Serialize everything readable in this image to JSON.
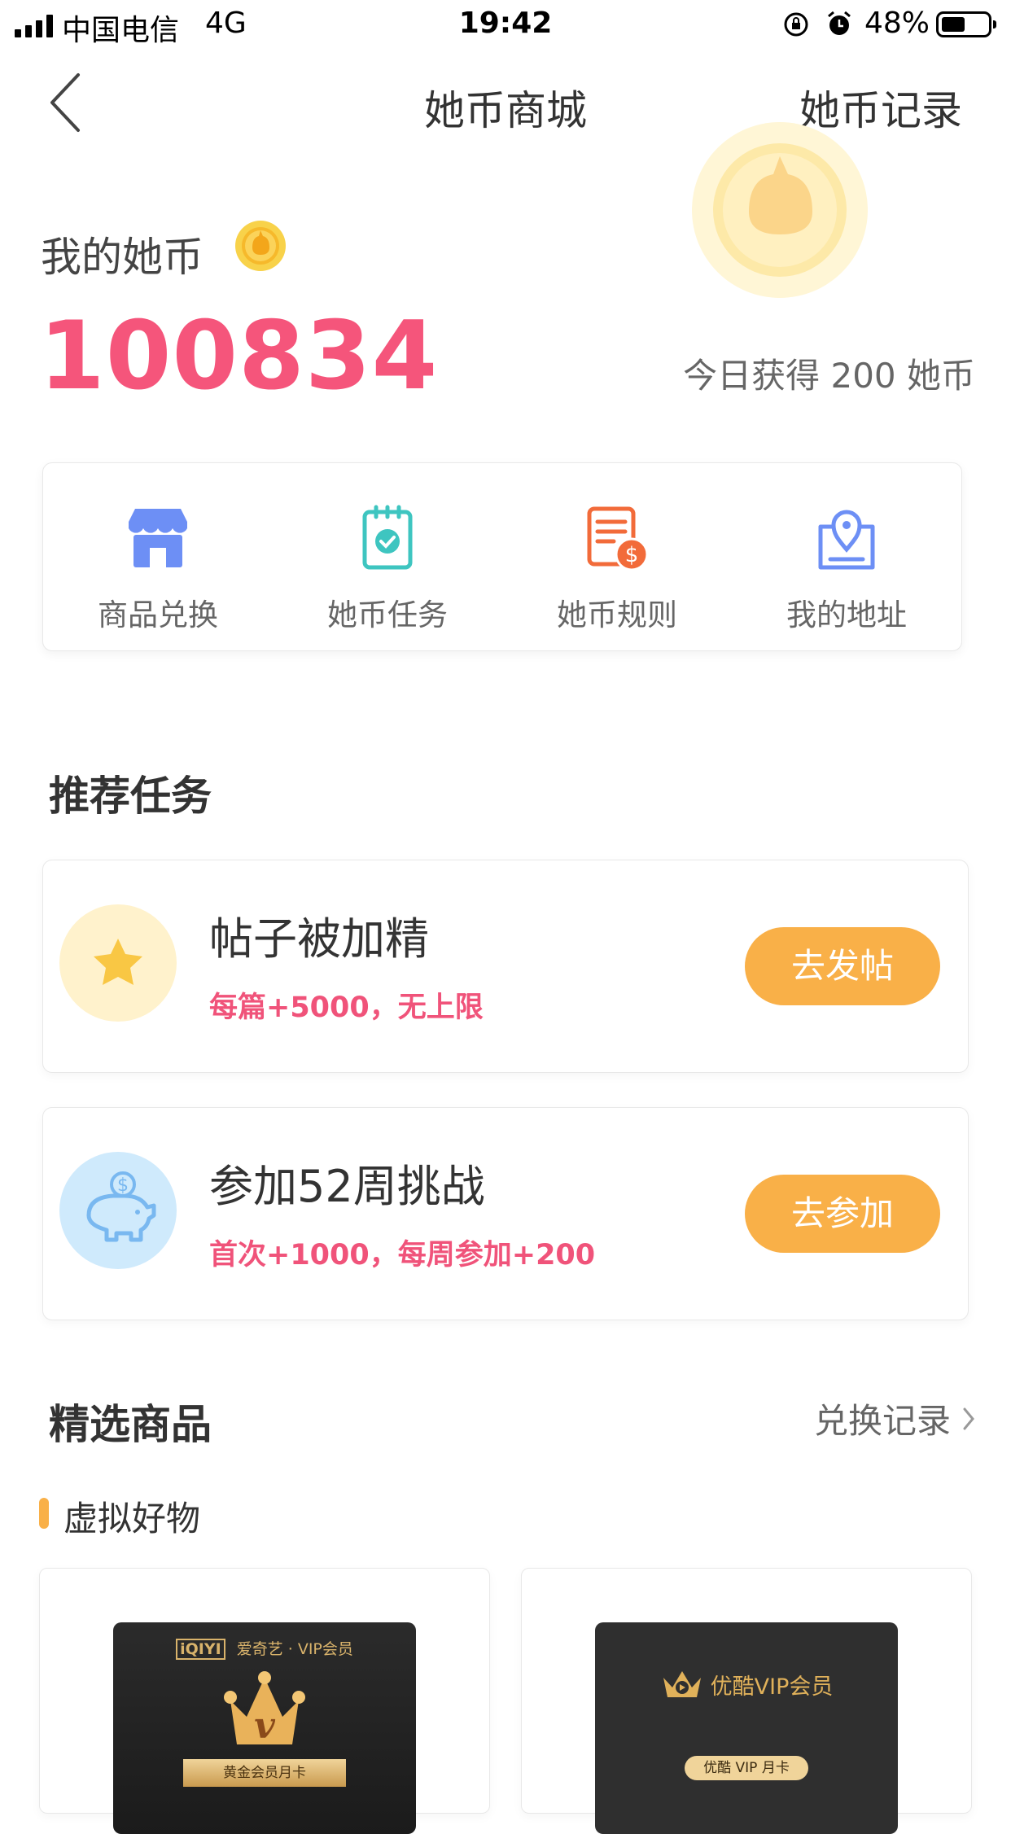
{
  "status_bar": {
    "carrier": "中国电信",
    "network": "4G",
    "time": "19:42",
    "battery": "48%",
    "battery_level": 0.48
  },
  "nav": {
    "title": "她币商城",
    "right_link": "她币记录"
  },
  "balance": {
    "label": "我的她币",
    "amount": "100834",
    "today": "今日获得 200 她币"
  },
  "quick_menu": [
    {
      "label": "商品兑换",
      "icon": "store-icon",
      "color": "#6d8ff5"
    },
    {
      "label": "她币任务",
      "icon": "task-clipboard-icon",
      "color": "#3ec5c0"
    },
    {
      "label": "她币规则",
      "icon": "rules-document-icon",
      "color": "#f26b3a"
    },
    {
      "label": "我的地址",
      "icon": "location-pin-icon",
      "color": "#6d8ff5"
    }
  ],
  "recommended": {
    "title": "推荐任务",
    "tasks": [
      {
        "title": "帖子被加精",
        "subtitle": "每篇+5000，无上限",
        "button": "去发帖",
        "icon": "star-icon"
      },
      {
        "title": "参加52周挑战",
        "subtitle": "首次+1000，每周参加+200",
        "button": "去参加",
        "icon": "piggy-bank-icon"
      }
    ]
  },
  "featured": {
    "title": "精选商品",
    "exchange_link": "兑换记录",
    "category": "虚拟好物",
    "products": [
      {
        "brand": "爱奇艺 · VIP会员",
        "logo": "iQIYI",
        "card": "黄金会员月卡"
      },
      {
        "brand": "优酷VIP会员",
        "card": "优酷 VIP 月卡"
      }
    ]
  },
  "colors": {
    "accent_pink": "#f5557b",
    "button_orange": "#f9b048",
    "coin_gold": "#f6c445"
  }
}
